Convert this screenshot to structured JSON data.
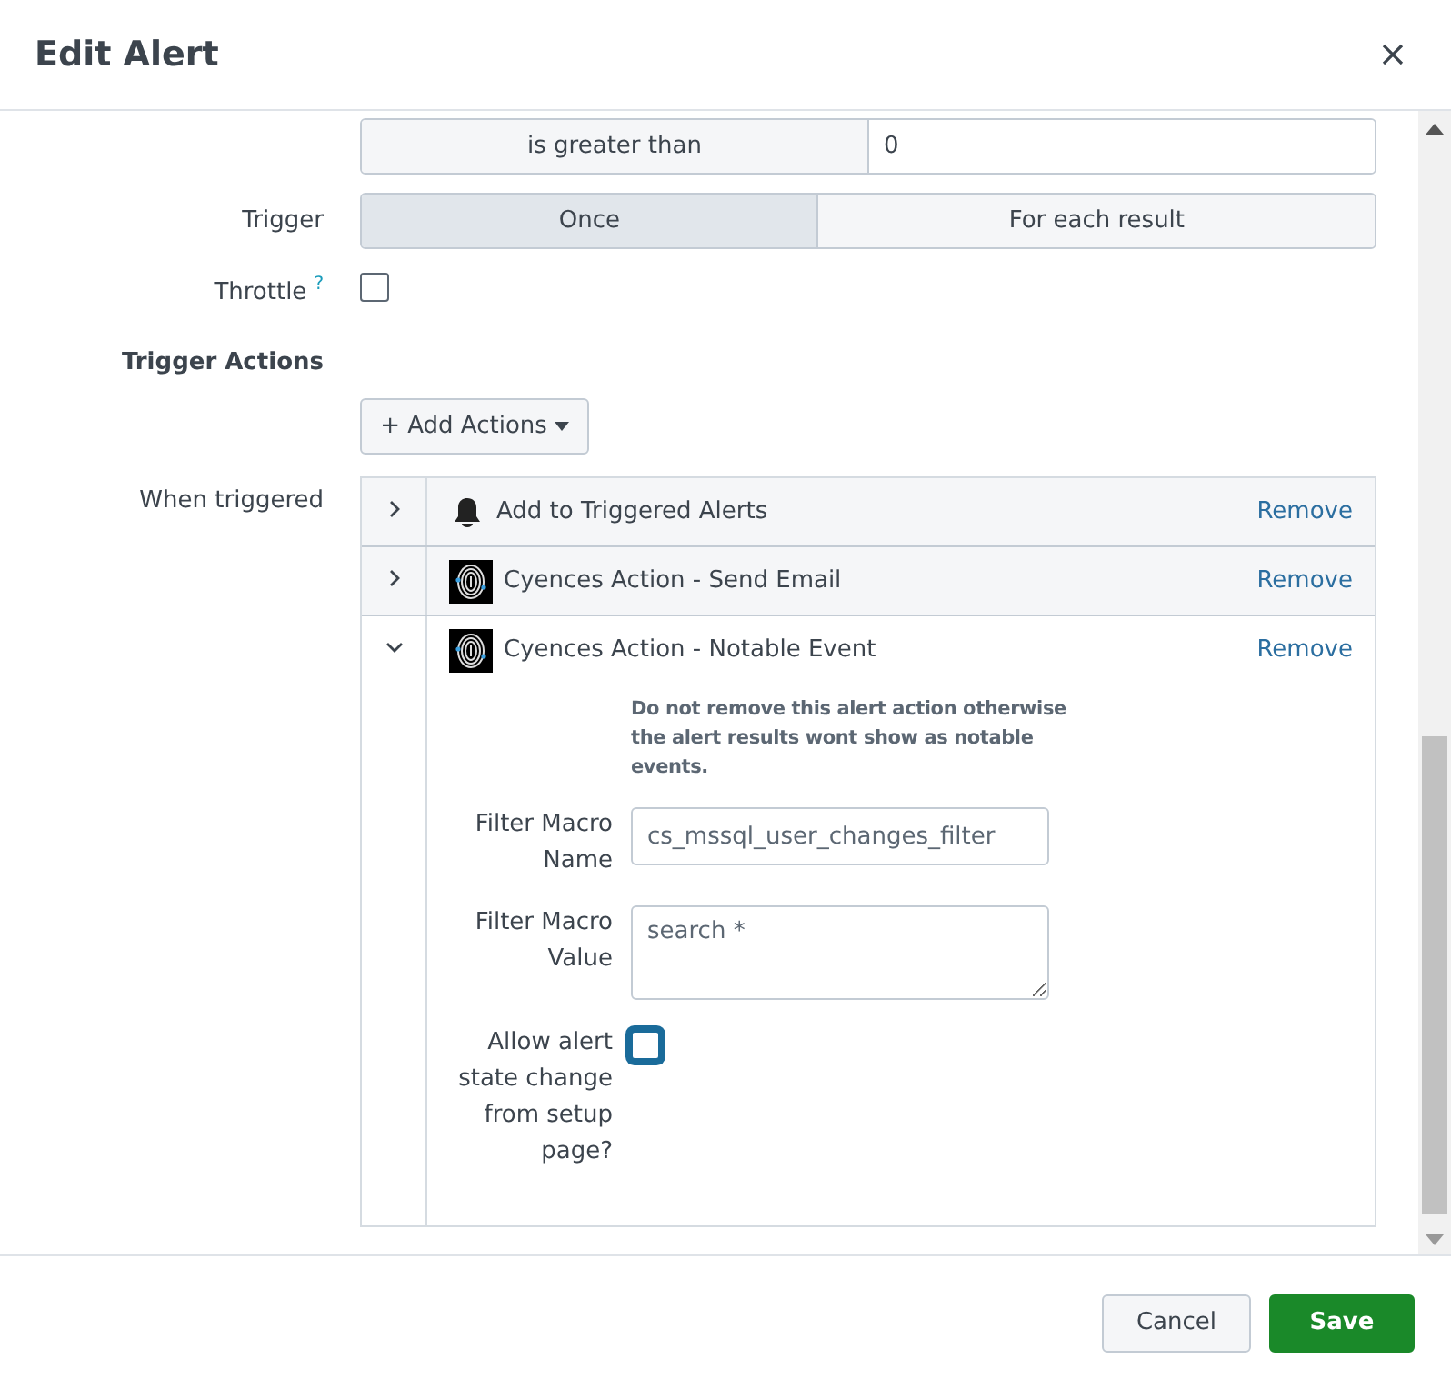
{
  "dialog": {
    "title": "Edit Alert"
  },
  "condition": {
    "comparator": "is greater than",
    "value": "0"
  },
  "trigger": {
    "label": "Trigger",
    "options": [
      {
        "label": "Once",
        "selected": true
      },
      {
        "label": "For each result",
        "selected": false
      }
    ]
  },
  "throttle": {
    "label": "Throttle",
    "help": "?",
    "checked": false
  },
  "section_title": "Trigger Actions",
  "add_actions": {
    "label": "+ Add Actions"
  },
  "actions": {
    "label": "When triggered",
    "items": [
      {
        "name": "Add to Triggered Alerts",
        "kind": "bell",
        "expanded": false,
        "remove": "Remove"
      },
      {
        "name": "Cyences Action - Send Email",
        "kind": "fingerprint",
        "expanded": false,
        "remove": "Remove"
      },
      {
        "name": "Cyences Action - Notable Event",
        "kind": "fingerprint",
        "expanded": true,
        "remove": "Remove",
        "details": {
          "note": "Do not remove this alert action otherwise the alert results wont show as notable events.",
          "fields": [
            {
              "label": "Filter Macro Name",
              "kind": "input",
              "value": "cs_mssql_user_changes_filter"
            },
            {
              "label": "Filter Macro Value",
              "kind": "textarea",
              "value": "search *"
            },
            {
              "label": "Allow alert state change from setup page?",
              "kind": "checkbox",
              "checked": false
            }
          ]
        }
      }
    ]
  },
  "footer": {
    "buttons": [
      {
        "label": "Cancel",
        "kind": "secondary"
      },
      {
        "label": "Save",
        "kind": "primary"
      }
    ]
  }
}
